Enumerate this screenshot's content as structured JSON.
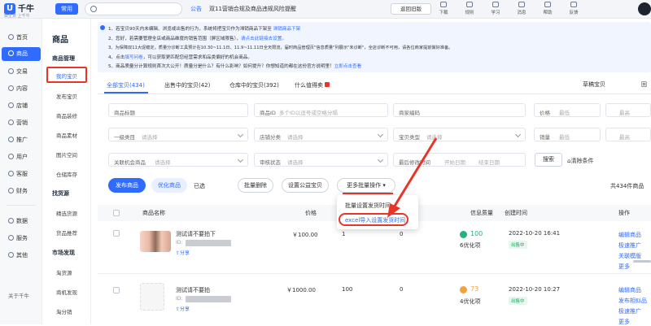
{
  "app": {
    "logo": "千牛",
    "slogan": "做生意 上千牛",
    "common_btn": "常用",
    "search_placeholder": "",
    "notice_tag": "公告",
    "notice_text": "双11营销合规及商品违规风险提醒",
    "back_old": "返回旧版",
    "toolbar": [
      {
        "label": "下载"
      },
      {
        "label": "规则"
      },
      {
        "label": "学习"
      },
      {
        "label": "消息"
      },
      {
        "label": "帮助"
      },
      {
        "label": "反馈"
      }
    ]
  },
  "rail": {
    "items": [
      {
        "label": "首页"
      },
      {
        "label": "商品"
      },
      {
        "label": "交易"
      },
      {
        "label": "内容"
      },
      {
        "label": "店铺"
      },
      {
        "label": "营销"
      },
      {
        "label": "推广"
      },
      {
        "label": "用户"
      },
      {
        "label": "客服"
      },
      {
        "label": "财务"
      },
      {
        "label": "数据"
      },
      {
        "label": "服务"
      },
      {
        "label": "其他"
      }
    ],
    "footer": "关于千牛"
  },
  "subnav": {
    "title": "商品",
    "groups": [
      {
        "label": "商品管理",
        "items": [
          "我的宝贝",
          "发布宝贝",
          "商品装修",
          "商品素材",
          "图片空间",
          "仓储库存"
        ]
      },
      {
        "label": "找货源",
        "items": [
          "精选货源",
          "货品推荐"
        ]
      },
      {
        "label": "市场发现",
        "items": [
          "淘货源",
          "商机发现",
          "淘分销"
        ]
      }
    ]
  },
  "tips": [
    {
      "text": "1、若宝贝90天内未编辑、浏览或出售的行为，系统将把宝贝作为滞销商品下架至 ",
      "link": "滞销商品下架"
    },
    {
      "text": "2、您好，若需要管理全店或商品维度的销售范围（屏区域限售），",
      "link": "请点击此链接去设置。"
    },
    {
      "text": "3、为保障双11大促稳定，质量分诊断工具预计在10.30~11.1日、11.9~11.11日全天限流，届时商品管理页\"信息质量\"列展示\"未诊断\"，全店诊断不可用，请各位商家提前做好准备。",
      "link": ""
    },
    {
      "text": "4、点击",
      "link": "填写问卷",
      "text2": "，可以获取更匹配您经营需求和品类偏好的机会商品。"
    },
    {
      "text": "5、商品质量分计算规则首次大公开！质量分是什么？有什么影响？如何提升？你想知道的都在这份官方说明里！",
      "link": "立即点击查看"
    }
  ],
  "tabs": [
    {
      "label": "全部宝贝(434)"
    },
    {
      "label": "出售中的宝贝(42)"
    },
    {
      "label": "仓库中的宝贝(392)"
    },
    {
      "label": "什么值得卖"
    }
  ],
  "grass_btn": "草稿宝贝",
  "filters": {
    "product_title": "商品标题",
    "product_id": "商品ID",
    "product_id_ph": "多个ID以逗号或空格分隔",
    "merchant_code": "商家编码",
    "price": "价格",
    "min": "最低",
    "max": "最高",
    "category1": "一级类目",
    "select_ph": "请选择",
    "shop_cat": "店铺分类",
    "sell_price": "销量",
    "item_type": "宝贝类型",
    "stock": "库存",
    "related": "关联机会商品",
    "audit": "审核状态",
    "last_modified": "最后修改时间",
    "start_date": "开始日期",
    "end_date": "结束日期",
    "sales": "销量",
    "search_btn": "搜索",
    "clear_btn": "清除条件"
  },
  "actions": {
    "publish": "发布商品",
    "optimize": "优化商品",
    "selected": "已选",
    "batch_delete": "批量删除",
    "public_welfare": "设置公益宝贝",
    "more_batch": "更多批量操作",
    "total": "共434件商品"
  },
  "dropdown": {
    "items": [
      "批量设置发货时间",
      "excel导入设置发货时间"
    ]
  },
  "table": {
    "headers": [
      "商品名称",
      "价格",
      "库存",
      "销量",
      "信息质量",
      "创建时间",
      "操作"
    ],
    "rows": [
      {
        "name": "测试请不要拍下",
        "id_prefix": "ID:",
        "share": "分享",
        "price": "￥100.00",
        "stock": "1",
        "sales": "0",
        "quality_score": "100",
        "quality_note": "6优化项",
        "created": "2022-10-20 16:41",
        "status": "出售中",
        "ops": [
          "编辑商品",
          "极速推广",
          "关联模版",
          "更多"
        ]
      },
      {
        "name": "测试请不要拍",
        "id_prefix": "ID:",
        "share": "分享",
        "price": "￥1000.00",
        "stock": "100",
        "sales": "0",
        "quality_score": "73",
        "quality_note": "4优化项",
        "created": "2022-10-20 10:27",
        "status": "出售中",
        "ops": [
          "编辑商品",
          "发布相似品",
          "极速推广",
          "更多"
        ]
      }
    ]
  },
  "colors": {
    "primary": "#2f6bff",
    "annotation_red": "#e8352b",
    "status_green": "#1aa35a"
  }
}
